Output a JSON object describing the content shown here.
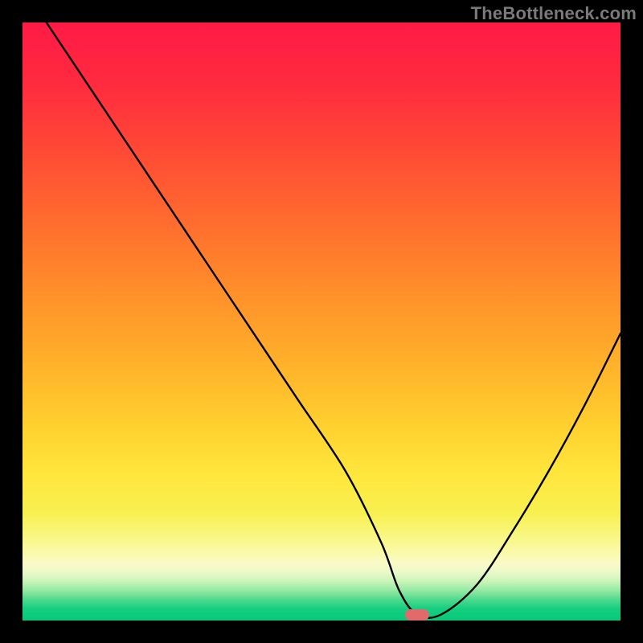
{
  "watermark": "TheBottleneck.com",
  "marker": {
    "x_pct": 66,
    "y_pct": 99
  },
  "chart_data": {
    "type": "line",
    "title": "",
    "xlabel": "",
    "ylabel": "",
    "xlim": [
      0,
      100
    ],
    "ylim": [
      0,
      100
    ],
    "series": [
      {
        "name": "bottleneck-curve",
        "x": [
          4,
          12,
          20,
          24,
          30,
          38,
          46,
          54,
          60,
          63,
          66,
          70,
          76,
          82,
          88,
          94,
          100
        ],
        "y": [
          100,
          88,
          76,
          70,
          61,
          49,
          37,
          25,
          13,
          5,
          1,
          1,
          6,
          15,
          25,
          36,
          48
        ]
      }
    ],
    "annotations": [
      {
        "type": "marker",
        "shape": "pill",
        "x": 66,
        "y": 1,
        "color": "#e26a6a"
      }
    ],
    "background": {
      "type": "vertical-gradient",
      "stops": [
        {
          "pos": 0,
          "color": "#ff1a46"
        },
        {
          "pos": 50,
          "color": "#ff9a2a"
        },
        {
          "pos": 80,
          "color": "#ffe73e"
        },
        {
          "pos": 100,
          "color": "#07c97a"
        }
      ]
    }
  }
}
